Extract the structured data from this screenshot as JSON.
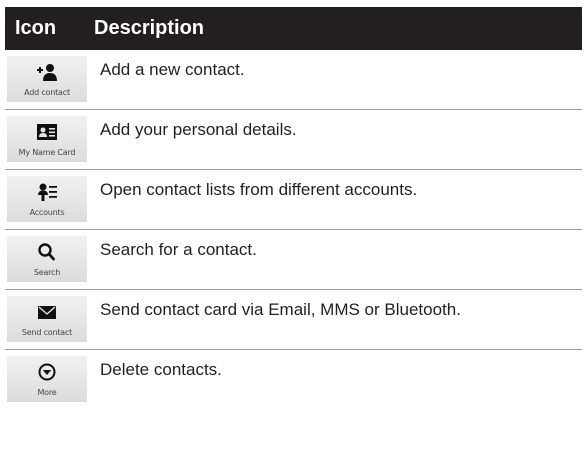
{
  "header": {
    "icon_col": "Icon",
    "desc_col": "Description"
  },
  "rows": [
    {
      "icon": "add-contact-icon",
      "label": "Add contact",
      "description": "Add a new contact."
    },
    {
      "icon": "name-card-icon",
      "label": "My Name Card",
      "description": "Add your personal details."
    },
    {
      "icon": "accounts-icon",
      "label": "Accounts",
      "description": "Open contact lists from different accounts."
    },
    {
      "icon": "search-icon",
      "label": "Search",
      "description": "Search for a contact."
    },
    {
      "icon": "envelope-icon",
      "label": "Send contact",
      "description": "Send contact card via Email, MMS or Bluetooth."
    },
    {
      "icon": "more-icon",
      "label": "More",
      "description": "Delete contacts."
    }
  ],
  "colors": {
    "header_bg": "#231f20",
    "header_text": "#ffffff",
    "divider": "#9a9a9a",
    "icon_bg": "#e6e6e6"
  }
}
